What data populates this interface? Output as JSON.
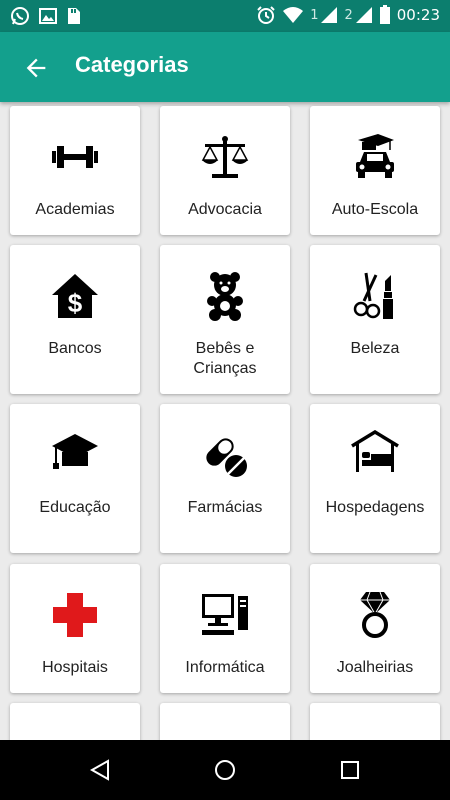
{
  "status_bar": {
    "time": "00:23",
    "sim1": "1",
    "sim2": "2",
    "left_icons": [
      "whatsapp-icon",
      "image-icon",
      "sd-card-icon"
    ],
    "right_icons": [
      "alarm-icon",
      "wifi-icon",
      "signal-icon",
      "battery-icon"
    ]
  },
  "app_bar": {
    "title": "Categorias",
    "back_icon": "arrow-left-icon"
  },
  "categories": [
    {
      "label": "Academias",
      "icon": "dumbbell-icon"
    },
    {
      "label": "Advocacia",
      "icon": "scales-icon"
    },
    {
      "label": "Auto-Escola",
      "icon": "car-graduation-icon"
    },
    {
      "label": "Bancos",
      "icon": "bank-house-dollar-icon"
    },
    {
      "label": "Bebês e Crianças",
      "icon": "teddy-bear-icon"
    },
    {
      "label": "Beleza",
      "icon": "scissors-lipstick-icon"
    },
    {
      "label": "Educação",
      "icon": "graduation-cap-icon"
    },
    {
      "label": "Farmácias",
      "icon": "pills-icon"
    },
    {
      "label": "Hospedagens",
      "icon": "bed-house-icon"
    },
    {
      "label": "Hospitais",
      "icon": "red-cross-icon"
    },
    {
      "label": "Informática",
      "icon": "computer-icon"
    },
    {
      "label": "Joalheirias",
      "icon": "diamond-ring-icon"
    }
  ],
  "colors": {
    "app_bar": "#13a08d",
    "status_bar": "#0c7e6e",
    "background": "#ebebeb",
    "cross_red": "#e0191b"
  },
  "nav_bar": {
    "icons": [
      "back-triangle-icon",
      "home-circle-icon",
      "recents-square-icon"
    ]
  }
}
